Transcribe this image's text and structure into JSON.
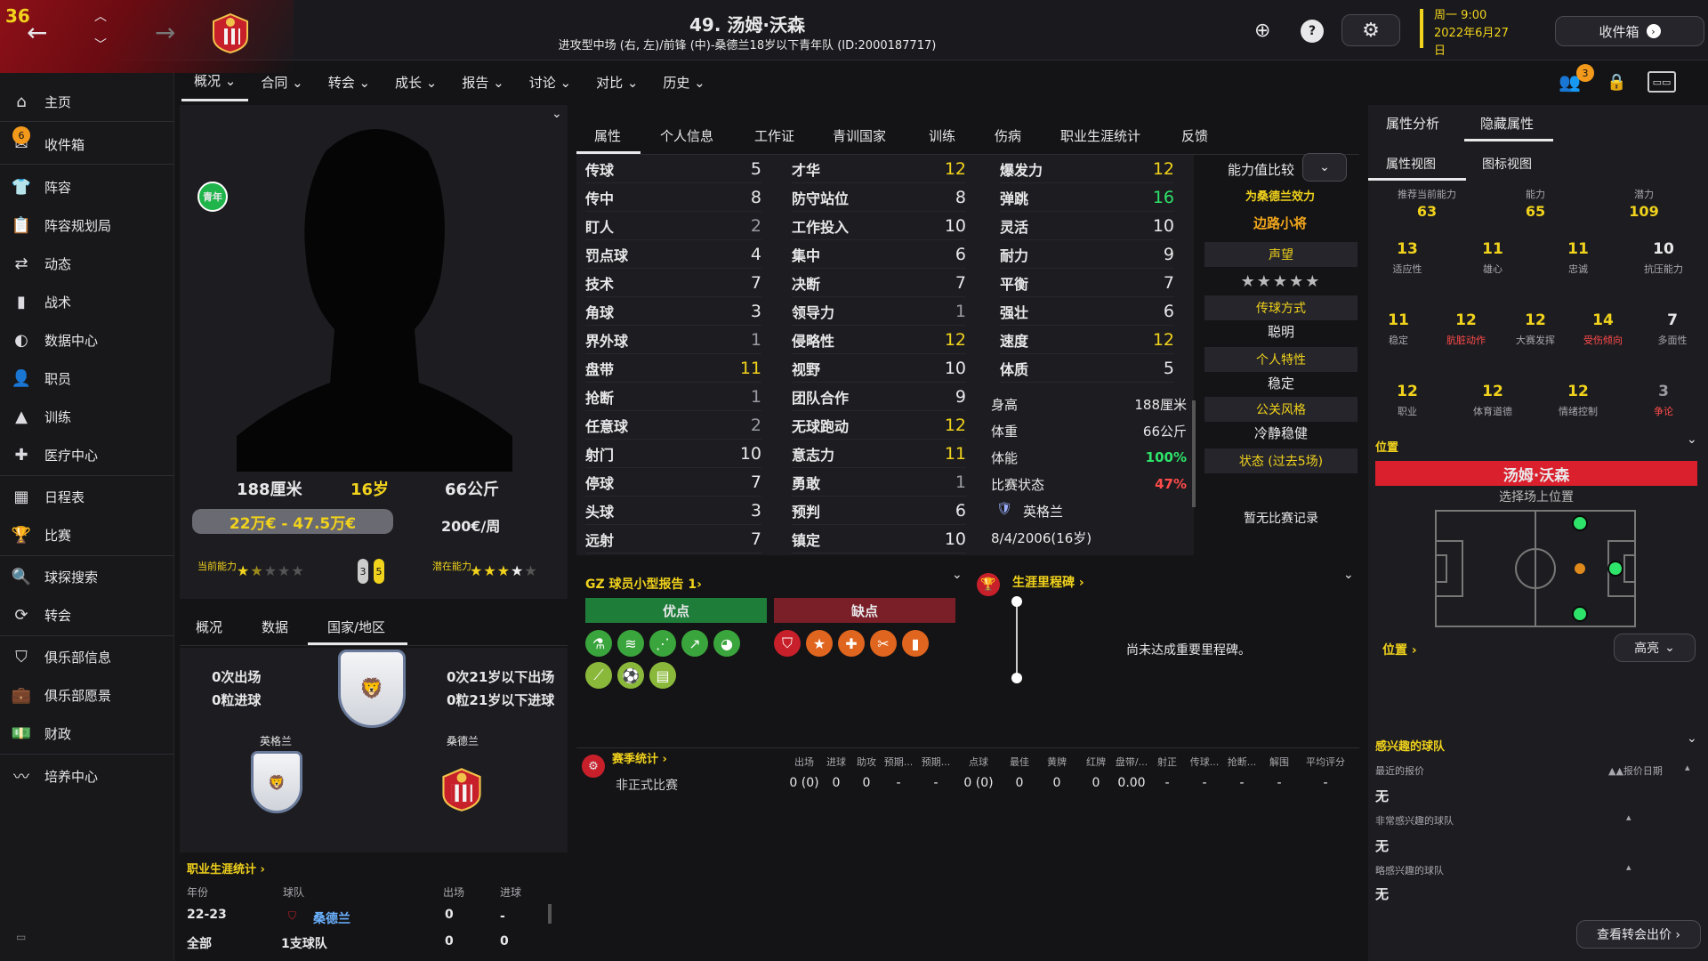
{
  "window": {
    "ca_number": "36"
  },
  "header": {
    "title": "49. 汤姆·沃森",
    "subtitle": "进攻型中场 (右, 左)/前锋 (中)-桑德兰18岁以下青年队 (ID:2000187717)",
    "date_weekday": "周一 9:00",
    "date_full": "2022年6月27",
    "date_tail": "日",
    "inbox_button": "收件箱",
    "notif_count": "3"
  },
  "subnav": [
    "概况 ⌄",
    "合同 ⌄",
    "转会 ⌄",
    "成长 ⌄",
    "报告 ⌄",
    "讨论 ⌄",
    "对比 ⌄",
    "历史 ⌄"
  ],
  "sidebar": {
    "items": [
      {
        "label": "主页",
        "icon": "home-icon"
      },
      {
        "label": "收件箱",
        "icon": "inbox-icon",
        "badge": "6"
      },
      {
        "label": "阵容",
        "icon": "shirt-icon"
      },
      {
        "label": "阵容规划局",
        "icon": "clipboard-icon"
      },
      {
        "label": "动态",
        "icon": "dynamics-icon"
      },
      {
        "label": "战术",
        "icon": "tactics-icon"
      },
      {
        "label": "数据中心",
        "icon": "data-icon"
      },
      {
        "label": "职员",
        "icon": "staff-icon"
      },
      {
        "label": "训练",
        "icon": "training-icon"
      },
      {
        "label": "医疗中心",
        "icon": "medical-icon"
      },
      {
        "label": "日程表",
        "icon": "calendar-icon"
      },
      {
        "label": "比赛",
        "icon": "trophy-icon"
      },
      {
        "label": "球探搜索",
        "icon": "search-icon"
      },
      {
        "label": "转会",
        "icon": "transfer-icon"
      },
      {
        "label": "俱乐部信息",
        "icon": "shield-icon"
      },
      {
        "label": "俱乐部愿景",
        "icon": "vision-icon"
      },
      {
        "label": "财政",
        "icon": "finance-icon"
      },
      {
        "label": "培养中心",
        "icon": "development-icon"
      }
    ]
  },
  "player": {
    "youth_badge": "青年",
    "height": "188厘米",
    "age": "16岁",
    "weight": "66公斤",
    "value": "22万€ - 47.5万€",
    "wage": "200€/周",
    "ca_label": "当前能力",
    "pa_label": "潜在能力",
    "ca_stars": 1.5,
    "pa_stars": 4,
    "badge_a": "3",
    "badge_b": "5"
  },
  "lefttabs": [
    "概况",
    "数据",
    "国家/地区"
  ],
  "nation": {
    "left_apps": "0次出场",
    "left_goals": "0粒进球",
    "right_apps": "0次21岁以下出场",
    "right_goals": "0粒21岁以下进球",
    "team_a": "英格兰",
    "team_b": "桑德兰"
  },
  "career": {
    "title": "职业生涯统计 ›",
    "headers": [
      "年份",
      "球队",
      "出场",
      "进球"
    ],
    "rows": [
      [
        "22-23",
        "桑德兰",
        "0",
        "-"
      ],
      [
        "全部",
        "1支球队",
        "0",
        "0"
      ]
    ]
  },
  "main_tabs": [
    "属性",
    "个人信息",
    "工作证",
    "青训国家",
    "训练",
    "伤病",
    "职业生涯统计",
    "反馈"
  ],
  "technical": [
    [
      "传球",
      "5"
    ],
    [
      "传中",
      "8"
    ],
    [
      "盯人",
      "2"
    ],
    [
      "罚点球",
      "4"
    ],
    [
      "技术",
      "7"
    ],
    [
      "角球",
      "3"
    ],
    [
      "界外球",
      "1"
    ],
    [
      "盘带",
      "11"
    ],
    [
      "抢断",
      "1"
    ],
    [
      "任意球",
      "2"
    ],
    [
      "射门",
      "10"
    ],
    [
      "停球",
      "7"
    ],
    [
      "头球",
      "3"
    ],
    [
      "远射",
      "7"
    ]
  ],
  "mental": [
    [
      "才华",
      "12"
    ],
    [
      "防守站位",
      "8"
    ],
    [
      "工作投入",
      "10"
    ],
    [
      "集中",
      "6"
    ],
    [
      "决断",
      "7"
    ],
    [
      "领导力",
      "1"
    ],
    [
      "侵略性",
      "12"
    ],
    [
      "视野",
      "10"
    ],
    [
      "团队合作",
      "9"
    ],
    [
      "无球跑动",
      "12"
    ],
    [
      "意志力",
      "11"
    ],
    [
      "勇敢",
      "1"
    ],
    [
      "预判",
      "6"
    ],
    [
      "镇定",
      "10"
    ]
  ],
  "physical": [
    [
      "爆发力",
      "12"
    ],
    [
      "弹跳",
      "16"
    ],
    [
      "灵活",
      "10"
    ],
    [
      "耐力",
      "9"
    ],
    [
      "平衡",
      "7"
    ],
    [
      "强壮",
      "6"
    ],
    [
      "速度",
      "12"
    ],
    [
      "体质",
      "5"
    ]
  ],
  "info": [
    [
      "身高",
      "188厘米"
    ],
    [
      "体重",
      "66公斤"
    ],
    [
      "体能",
      "100%"
    ],
    [
      "比赛状态",
      "47%"
    ]
  ],
  "nationality": "英格兰",
  "dob": "8/4/2006(16岁)",
  "compare": {
    "label": "能力值比较",
    "plays_for": "为桑德兰效力",
    "role": "边路小将",
    "reputation_label": "声望",
    "pass_label": "传球方式",
    "pass_value": "聪明",
    "personality_label": "个人特性",
    "personality_value": "稳定",
    "media_label": "公关风格",
    "media_value": "冷静稳健",
    "form_label": "状态 (过去5场)",
    "no_matches": "暂无比赛记录"
  },
  "report": {
    "title": "GZ 球员小型报告 1›",
    "pros_label": "优点",
    "cons_label": "缺点"
  },
  "milestones": {
    "title": "生涯里程碑 ›",
    "empty": "尚未达成重要里程碑。"
  },
  "season": {
    "title": "赛季统计 ›",
    "headers": [
      "出场",
      "进球",
      "助攻",
      "预期...",
      "预期...",
      "点球",
      "最佳",
      "黄牌",
      "红牌",
      "盘带/...",
      "射正",
      "传球...",
      "抢断...",
      "解围",
      "平均评分"
    ],
    "row_label": "非正式比赛",
    "row": [
      "0 (0)",
      "0",
      "0",
      "-",
      "-",
      "0 (0)",
      "0",
      "0",
      "0",
      "0.00",
      "-",
      "-",
      "-",
      "-",
      "-"
    ]
  },
  "right": {
    "tabs": [
      "属性分析",
      "隐藏属性"
    ],
    "subtabs": [
      "属性视图",
      "图标视图"
    ],
    "top": [
      [
        "推荐当前能力",
        "63"
      ],
      [
        "能力",
        "65"
      ],
      [
        "潜力",
        "109"
      ]
    ],
    "hidden": [
      [
        "13",
        "适应性"
      ],
      [
        "11",
        "雄心"
      ],
      [
        "11",
        "忠诚"
      ],
      [
        "10",
        "抗压能力"
      ],
      [
        "11",
        "稳定"
      ],
      [
        "12",
        "肮脏动作"
      ],
      [
        "12",
        "大赛发挥"
      ],
      [
        "14",
        "受伤倾向"
      ],
      [
        "7",
        "多面性"
      ],
      [
        "12",
        "职业"
      ],
      [
        "12",
        "体育道德"
      ],
      [
        "12",
        "情绪控制"
      ],
      [
        "3",
        "争论"
      ]
    ],
    "position_label": "位置",
    "position_banner": "汤姆·沃森",
    "position_hint": "选择场上位置",
    "position_link": "位置 ›",
    "highlight_btn": "高亮",
    "interest_title": "感兴趣的球队",
    "latest_bid": "最近的报价",
    "bid_date": "▲▲报价日期",
    "none": "无",
    "very_interested": "非常感兴趣的球队",
    "somewhat_interested": "略感兴趣的球队",
    "transfer_btn": "查看转会出价 ›"
  },
  "colors": {
    "accent": "#f1d21c",
    "green": "#2ee36a",
    "red": "#d9202c"
  }
}
